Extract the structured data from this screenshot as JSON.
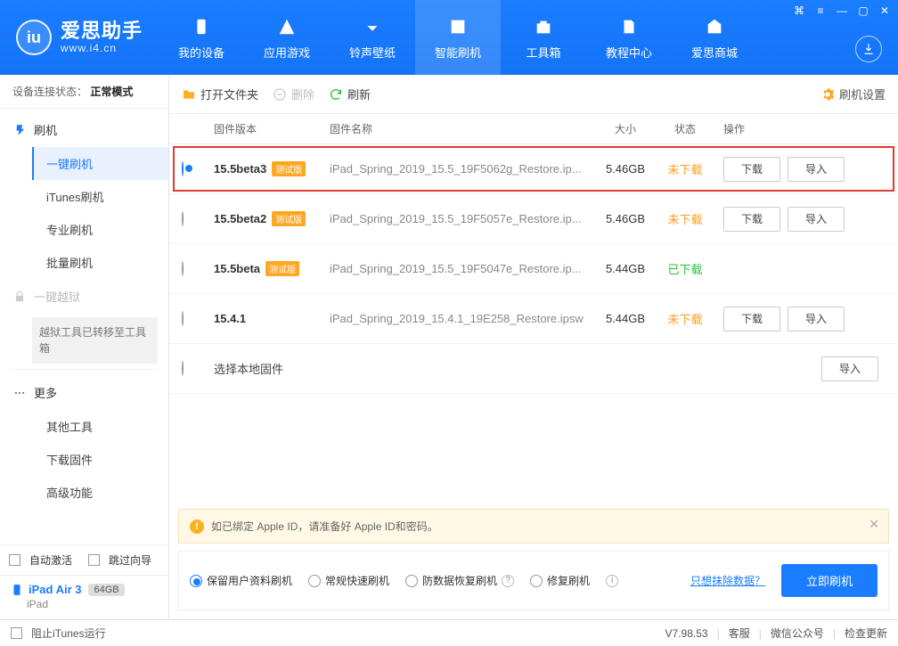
{
  "brand": {
    "cn": "爱思助手",
    "en": "www.i4.cn",
    "badge": "iu"
  },
  "nav": [
    {
      "label": "我的设备"
    },
    {
      "label": "应用游戏"
    },
    {
      "label": "铃声壁纸"
    },
    {
      "label": "智能刷机"
    },
    {
      "label": "工具箱"
    },
    {
      "label": "教程中心"
    },
    {
      "label": "爱思商城"
    }
  ],
  "nav_active_index": 3,
  "sidebar": {
    "status_label": "设备连接状态：",
    "status_value": "正常模式",
    "groups": {
      "flash": {
        "title": "刷机",
        "items": [
          "一键刷机",
          "iTunes刷机",
          "专业刷机",
          "批量刷机"
        ],
        "active_index": 0
      },
      "jailbreak": {
        "title": "一键越狱",
        "notice": "越狱工具已转移至工具箱"
      },
      "more": {
        "title": "更多",
        "items": [
          "其他工具",
          "下载固件",
          "高级功能"
        ]
      }
    },
    "auto_activate": "自动激活",
    "skip_guide": "跳过向导",
    "device": {
      "name": "iPad Air 3",
      "capacity": "64GB",
      "type": "iPad"
    }
  },
  "toolbar": {
    "open_folder": "打开文件夹",
    "delete": "删除",
    "refresh": "刷新",
    "settings": "刷机设置"
  },
  "columns": {
    "version": "固件版本",
    "name": "固件名称",
    "size": "大小",
    "status": "状态",
    "action": "操作"
  },
  "beta_tag": "测试版",
  "actions": {
    "download": "下载",
    "import": "导入"
  },
  "status_labels": {
    "not_downloaded": "未下载",
    "downloaded": "已下载"
  },
  "firmware": [
    {
      "version": "15.5beta3",
      "beta": true,
      "name": "iPad_Spring_2019_15.5_19F5062g_Restore.ip...",
      "size": "5.46GB",
      "status": "not_downloaded",
      "selected": true,
      "highlight": true,
      "show_download": true,
      "show_import": true,
      "is_text_row": false
    },
    {
      "version": "15.5beta2",
      "beta": true,
      "name": "iPad_Spring_2019_15.5_19F5057e_Restore.ip...",
      "size": "5.46GB",
      "status": "not_downloaded",
      "selected": false,
      "highlight": false,
      "show_download": true,
      "show_import": true,
      "is_text_row": false
    },
    {
      "version": "15.5beta",
      "beta": true,
      "name": "iPad_Spring_2019_15.5_19F5047e_Restore.ip...",
      "size": "5.44GB",
      "status": "downloaded",
      "selected": false,
      "highlight": false,
      "show_download": false,
      "show_import": false,
      "is_text_row": false
    },
    {
      "version": "15.4.1",
      "beta": false,
      "name": "iPad_Spring_2019_15.4.1_19E258_Restore.ipsw",
      "size": "5.44GB",
      "status": "not_downloaded",
      "selected": false,
      "highlight": false,
      "show_download": true,
      "show_import": true,
      "is_text_row": false
    },
    {
      "version": "选择本地固件",
      "beta": false,
      "name": "",
      "size": "",
      "status": "",
      "selected": false,
      "highlight": false,
      "show_download": false,
      "show_import": true,
      "is_text_row": true
    }
  ],
  "alert": "如已绑定 Apple ID，请准备好 Apple ID和密码。",
  "flash_options": [
    "保留用户资料刷机",
    "常规快速刷机",
    "防数据恢复刷机",
    "修复刷机"
  ],
  "flash_selected_index": 0,
  "erase_link": "只想抹除数据？",
  "flash_now": "立即刷机",
  "footer": {
    "block_itunes": "阻止iTunes运行",
    "support": "客服",
    "wechat": "微信公众号",
    "check_update": "检查更新",
    "version": "V7.98.53"
  }
}
